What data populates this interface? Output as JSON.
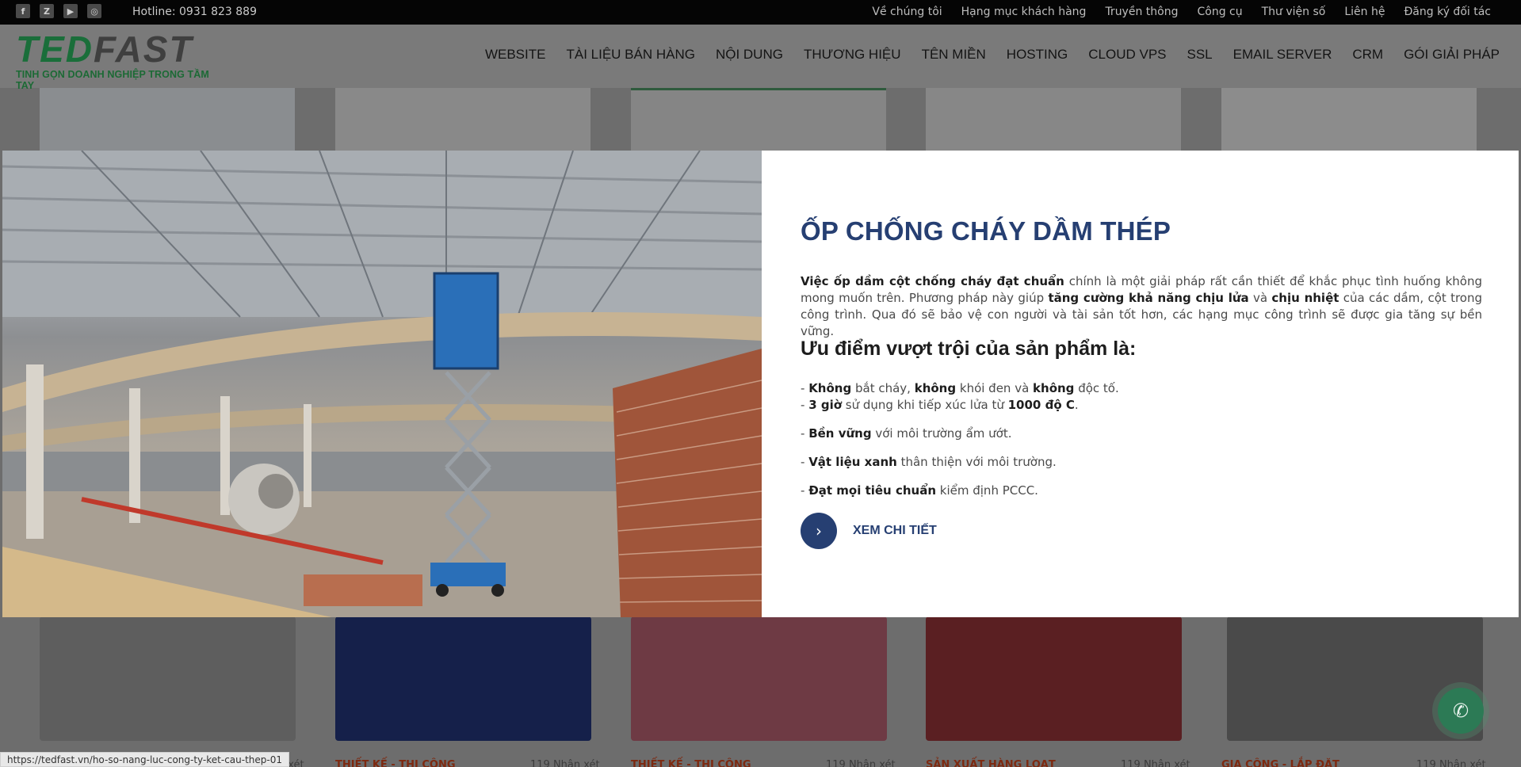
{
  "topbar": {
    "socials": [
      {
        "icon": "facebook-icon",
        "glyph": "f"
      },
      {
        "icon": "zalo-icon",
        "glyph": "Z"
      },
      {
        "icon": "youtube-icon",
        "glyph": "▶"
      },
      {
        "icon": "instagram-icon",
        "glyph": "◎"
      }
    ],
    "hotline": "Hotline: 0931 823 889",
    "links": [
      "Về chúng tôi",
      "Hạng mục khách hàng",
      "Truyền thông",
      "Công cụ",
      "Thư viện số",
      "Liên hệ",
      "Đăng ký đối tác"
    ]
  },
  "logo": {
    "mark_a": "TED",
    "mark_b": "FAST",
    "tagline": "TINH GỌN DOANH NGHIỆP TRONG TẦM TAY"
  },
  "nav": [
    "WEBSITE",
    "TÀI LIỆU BÁN HÀNG",
    "NỘI DUNG",
    "THƯƠNG HIỆU",
    "TÊN MIỀN",
    "HOSTING",
    "CLOUD VPS",
    "SSL",
    "EMAIL SERVER",
    "CRM",
    "GÓI GIẢI PHÁP"
  ],
  "modal": {
    "title": "ỐP CHỐNG CHÁY DẦM THÉP",
    "para": {
      "b1": "Việc ốp dầm cột chống cháy đạt chuẩn",
      "t1": " chính là một giải pháp rất cần thiết để khắc phục tình huống không mong muốn trên. Phương pháp này giúp ",
      "b2": "tăng cường khả năng chịu lửa",
      "t2": " và ",
      "b3": "chịu nhiệt",
      "t3": " của các dầm, cột trong công trình. Qua đó sẽ bảo vệ con người và tài sản tốt hơn, các hạng mục công trình sẽ được gia tăng sự bền vững."
    },
    "subtitle": "Ưu điểm vượt trội của sản phẩm là:",
    "list": {
      "l1": {
        "p0": "- ",
        "b1": "Không",
        "t1": " bắt cháy, ",
        "b2": "không",
        "t2": " khói đen và ",
        "b3": "không",
        "t3": " độc tố."
      },
      "l2": {
        "p0": "- ",
        "b1": "3 giờ",
        "t1": " sử dụng khi tiếp xúc lửa từ ",
        "b2": "1000 độ C",
        "t2": "."
      },
      "l3": {
        "p0": "- ",
        "b1": "Bền vững",
        "t1": " với môi trường ẩm ướt."
      },
      "l4": {
        "p0": "- ",
        "b1": "Vật liệu xanh",
        "t1": " thân thiện với môi trường."
      },
      "l5": {
        "p0": "- ",
        "b1": "Đạt mọi tiêu chuẩn",
        "t1": " kiểm định PCCC."
      }
    },
    "cta": "XEM CHI TIẾT"
  },
  "cards": [
    {
      "category": "THIẾT KẾ - THI CÔNG",
      "comments": "119 Nhận xét"
    },
    {
      "category": "THIẾT KẾ - THI CÔNG",
      "comments": "119 Nhận xét"
    },
    {
      "category": "SẢN XUẤT HÀNG LOẠT",
      "comments": "119 Nhận xét"
    },
    {
      "category": "GIA CÔNG - LẮP ĐẶT",
      "comments": "119 Nhận xét"
    }
  ],
  "first_card_comments": "119 Nhận xét",
  "status_url": "https://tedfast.vn/ho-so-nang-luc-cong-ty-ket-cau-thep-01"
}
